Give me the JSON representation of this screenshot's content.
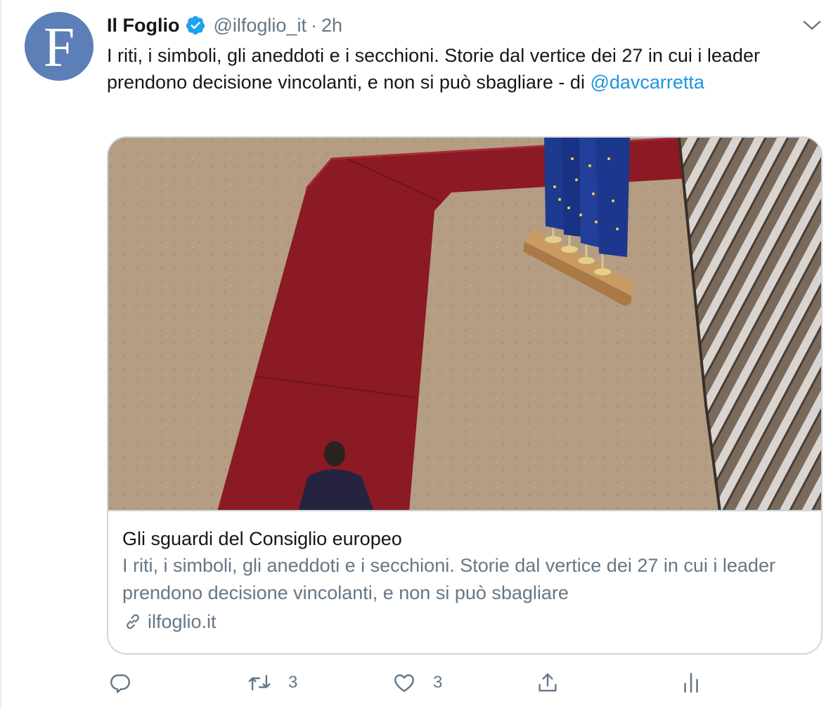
{
  "tweet": {
    "avatar_letter": "F",
    "name": "Il Foglio",
    "handle": "@ilfoglio_it",
    "separator": "·",
    "time": "2h",
    "text_main": "I riti, i simboli, gli aneddoti e i secchioni. Storie dal vertice dei 27 in cui i leader prendono decisione vincolanti, e non si può sbagliare - di ",
    "mention": "@davcarretta"
  },
  "card": {
    "title": "Gli sguardi del Consiglio europeo",
    "description": "I riti, i simboli, gli aneddoti e i secchioni. Storie dal vertice dei 27 in cui i leader prendono decisione vincolanti, e non si può sbagliare",
    "domain": "ilfoglio.it",
    "image_icon": "photo-red-carpet-eu-flags"
  },
  "actions": {
    "reply_icon": "reply-icon",
    "retweet_icon": "retweet-icon",
    "retweet_count": "3",
    "like_icon": "heart-icon",
    "like_count": "3",
    "share_icon": "share-icon",
    "analytics_icon": "analytics-icon"
  },
  "colors": {
    "accent": "#1b95e0",
    "secondary_text": "#657786",
    "border": "#ccd6dd",
    "avatar_bg": "#5b7fb6",
    "carpet": "#8b1a24"
  }
}
